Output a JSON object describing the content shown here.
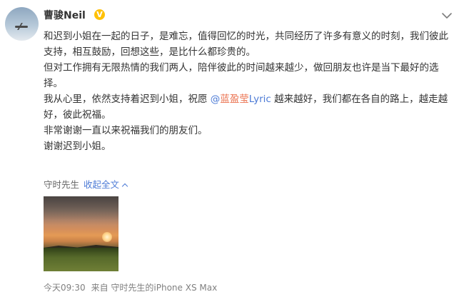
{
  "post": {
    "author": {
      "name": "曹骏Neil",
      "verified_symbol": "V"
    },
    "paragraphs": [
      "和迟到小姐在一起的日子，是难忘，值得回忆的时光，共同经历了许多有意义的时刻，我们彼此支持，相互鼓励，回想这些，是比什么都珍贵的。",
      "但对工作拥有无限热情的我们两人，陪伴彼此的时间越来越少，做回朋友也许是当下最好的选择。"
    ],
    "paragraph3": {
      "before": "我从心里，依然支持着迟到小姐，祝愿 ",
      "mention_at": "@",
      "mention_cn": "蓝盈莹",
      "mention_latin": "Lyric",
      "after": " 越来越好，我们都在各自的路上，越走越好，彼此祝福。"
    },
    "paragraph4": "非常谢谢一直以来祝福我们的朋友们。",
    "paragraph5": "谢谢迟到小姐。",
    "source_name": "守时先生",
    "collapse_label": "收起全文",
    "time": "今天09:30",
    "from_label": "来自 守时先生的iPhone XS Max"
  },
  "icons": {
    "more": "chevron-down-icon",
    "collapse": "chevron-up-icon"
  },
  "colors": {
    "link": "#4d7bd6",
    "mention": "#eb7350",
    "badge": "#ffc107",
    "meta": "#808080"
  }
}
